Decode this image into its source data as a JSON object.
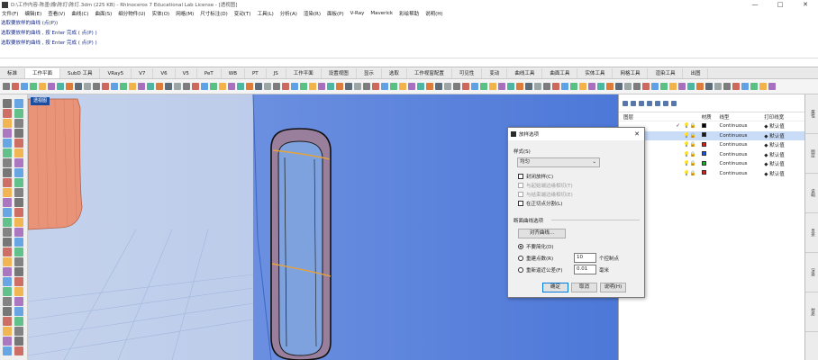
{
  "window": {
    "title": "D:\\工作内容-陈墨\\橡\\陈灯\\陈灯.3dm (225 KB) - Rhinoceros 7 Educational Lab License - [透视图]",
    "min": "—",
    "max": "□",
    "close": "✕"
  },
  "menu": [
    "文件(F)",
    "编辑(E)",
    "查看(V)",
    "曲线(C)",
    "曲面(S)",
    "细分物件(U)",
    "实体(O)",
    "网格(M)",
    "尺寸标注(D)",
    "变动(T)",
    "工具(L)",
    "分析(A)",
    "渲染(R)",
    "面板(P)",
    "V-Ray",
    "Maverick",
    "彩绘帮助",
    "说明(H)"
  ],
  "command_history": [
    "选取要放样的曲线 (点(P))",
    "选取要放样的曲线 , 按 Enter 完成 ( 点(P) )",
    "选取要放样的曲线 , 按 Enter 完成 ( 点(P) )"
  ],
  "tabs": [
    "标准",
    "工作平面",
    "SubD 工具",
    "VRay5",
    "V7",
    "V6",
    "V5",
    "PeT",
    "WB",
    "PT",
    "JS",
    "工作平面",
    "设置视图",
    "显示",
    "选取",
    "工作视窗配置",
    "可见性",
    "变动",
    "曲线工具",
    "曲面工具",
    "实体工具",
    "网格工具",
    "渲染工具",
    "出图"
  ],
  "active_tab_index": 1,
  "viewport": {
    "label": "透视图"
  },
  "layers": {
    "headers": {
      "name": "图层",
      "material": "材质",
      "linetype": "线型",
      "print": "打印线宽"
    },
    "rows": [
      {
        "name": "",
        "current": "✓",
        "color": "#000000",
        "linetype": "Continuous",
        "print": "默认值",
        "selected": false
      },
      {
        "name": "",
        "current": "",
        "color": "#1a1a1a",
        "linetype": "Continuous",
        "print": "默认值",
        "selected": true
      },
      {
        "name": "",
        "current": "",
        "color": "#cc2222",
        "linetype": "Continuous",
        "print": "默认值",
        "selected": false
      },
      {
        "name": "",
        "current": "",
        "color": "#2255cc",
        "linetype": "Continuous",
        "print": "默认值",
        "selected": false
      },
      {
        "name": "",
        "current": "",
        "color": "#22aa33",
        "linetype": "Continuous",
        "print": "默认值",
        "selected": false
      },
      {
        "name": "",
        "current": "",
        "color": "#cc2222",
        "linetype": "Continuous",
        "print": "默认值",
        "selected": false
      }
    ]
  },
  "right_strip": [
    "属性",
    "图层",
    "说明",
    "显示",
    "渲染",
    "材质"
  ],
  "dialog": {
    "title": "放样选项",
    "close": "✕",
    "style_label": "样式(S)",
    "style_value": "均匀",
    "opt_closed": "封闭放样(C)",
    "opt_start_tangent": "与起始端边缘相切(T)",
    "opt_end_tangent": "与结束端边缘相切(E)",
    "opt_split": "在正切点分割(L)",
    "section_label": "断面曲线选项",
    "align_button": "对齐曲线...",
    "radio_norebuild": "不要简化(D)",
    "radio_rebuild": "重建点数(R)",
    "rebuild_value": "10",
    "rebuild_unit": "个控制点",
    "radio_refit": "重新逼近公差(F)",
    "refit_value": "0.01",
    "refit_unit": "毫米",
    "ok": "确定",
    "cancel": "取消",
    "help": "说明(H)"
  }
}
